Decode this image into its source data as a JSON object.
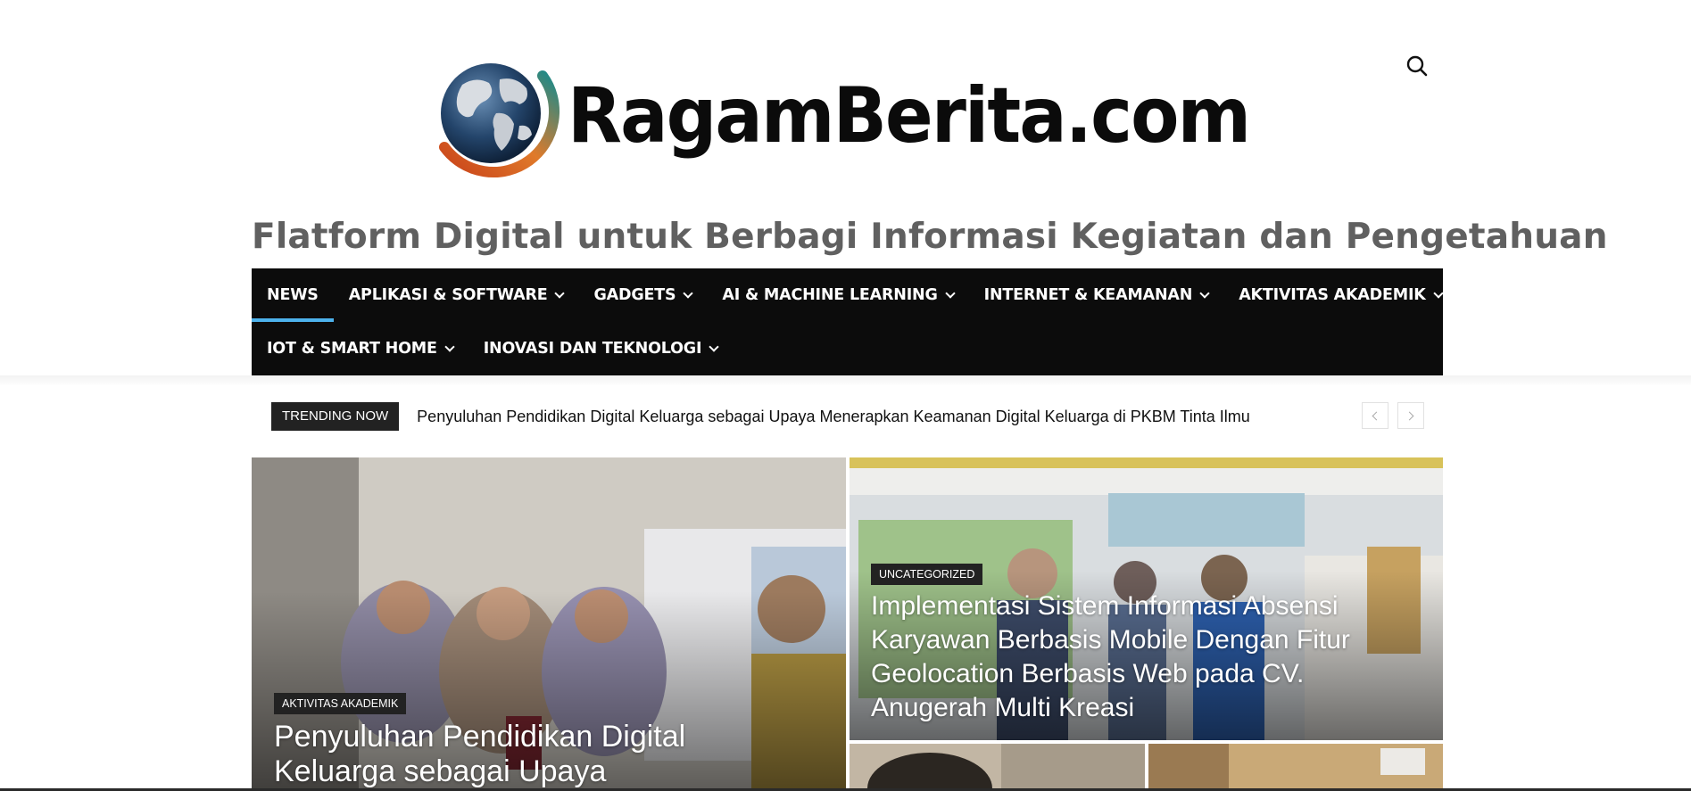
{
  "site": {
    "logo_text": "RagamBerita.com",
    "tagline": "Flatform Digital untuk Berbagi Informasi Kegiatan dan Pengetahuan"
  },
  "nav": {
    "items": [
      {
        "label": "NEWS",
        "dropdown": false,
        "active": true
      },
      {
        "label": "APLIKASI & SOFTWARE",
        "dropdown": true
      },
      {
        "label": "GADGETS",
        "dropdown": true
      },
      {
        "label": "AI & MACHINE LEARNING",
        "dropdown": true
      },
      {
        "label": "INTERNET & KEAMANAN",
        "dropdown": true
      },
      {
        "label": "AKTIVITAS AKADEMIK",
        "dropdown": true
      },
      {
        "label": "IOT & SMART HOME",
        "dropdown": true
      },
      {
        "label": "INOVASI DAN TEKNOLOGI",
        "dropdown": true
      }
    ],
    "active_color": "#4db2ec"
  },
  "trending": {
    "badge": "TRENDING NOW",
    "headline": "Penyuluhan Pendidikan Digital Keluarga sebagai Upaya Menerapkan Keamanan Digital Keluarga di PKBM Tinta Ilmu"
  },
  "featured": {
    "main": {
      "category": "AKTIVITAS AKADEMIK",
      "title": "Penyuluhan Pendidikan Digital Keluarga sebagai Upaya"
    },
    "side": {
      "category": "UNCATEGORIZED",
      "title": "Implementasi Sistem Informasi Absensi Karyawan Berbasis Mobile Dengan Fitur Geolocation Berbasis Web pada CV. Anugerah Multi Kreasi"
    }
  },
  "icons": {
    "search": "search-icon",
    "prev": "chevron-left-icon",
    "next": "chevron-right-icon"
  }
}
